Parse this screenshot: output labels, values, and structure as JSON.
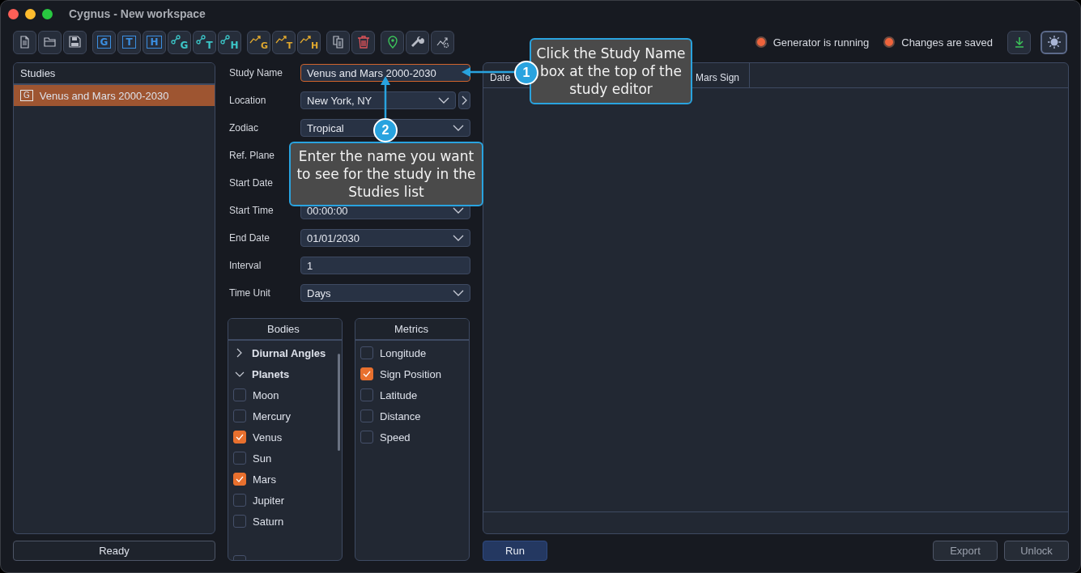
{
  "window": {
    "title": "Cygnus - New workspace"
  },
  "toolbar": [
    [
      {
        "kind": "file"
      },
      {
        "kind": "folder"
      },
      {
        "kind": "save"
      }
    ],
    [
      {
        "kind": "boxed",
        "letter": "G"
      },
      {
        "kind": "boxed",
        "letter": "T"
      },
      {
        "kind": "boxed",
        "letter": "H"
      },
      {
        "kind": "node",
        "letter": "G"
      },
      {
        "kind": "node",
        "letter": "T"
      },
      {
        "kind": "node",
        "letter": "H"
      }
    ],
    [
      {
        "kind": "trend",
        "letter": "G"
      },
      {
        "kind": "trend",
        "letter": "T"
      },
      {
        "kind": "trend",
        "letter": "H"
      }
    ],
    [
      {
        "kind": "copy"
      },
      {
        "kind": "trash"
      }
    ],
    [
      {
        "kind": "pin"
      },
      {
        "kind": "wrench"
      },
      {
        "kind": "trend-gear"
      }
    ]
  ],
  "indicators": [
    {
      "label": "Generator is running",
      "color": "#f0643c"
    },
    {
      "label": "Changes are saved",
      "color": "#f0643c"
    }
  ],
  "studies": {
    "title": "Studies",
    "items": [
      {
        "letter": "G",
        "label": "Venus and Mars 2000-2030",
        "selected": true
      }
    ]
  },
  "status": "Ready",
  "form": [
    {
      "label": "Study Name",
      "kind": "text",
      "value": "Venus and Mars 2000-2030",
      "focused": true
    },
    {
      "label": "Location",
      "kind": "dropdown",
      "value": "New York, NY",
      "more": true
    },
    {
      "label": "Zodiac",
      "kind": "dropdown",
      "value": "Tropical"
    },
    {
      "label": "Ref. Plane",
      "kind": "hidden"
    },
    {
      "label": "Start Date",
      "kind": "hidden"
    },
    {
      "label": "Start Time",
      "kind": "dropdown",
      "value": "00:00:00"
    },
    {
      "label": "End Date",
      "kind": "dropdown",
      "value": "01/01/2030"
    },
    {
      "label": "Interval",
      "kind": "text",
      "value": "1",
      "focused": false
    },
    {
      "label": "Time Unit",
      "kind": "dropdown",
      "value": "Days"
    }
  ],
  "bodies": {
    "title": "Bodies",
    "items": [
      {
        "kind": "group",
        "label": "Diurnal Angles",
        "expanded": false
      },
      {
        "kind": "group",
        "label": "Planets",
        "expanded": true
      },
      {
        "kind": "check",
        "label": "Moon",
        "checked": false
      },
      {
        "kind": "check",
        "label": "Mercury",
        "checked": false
      },
      {
        "kind": "check",
        "label": "Venus",
        "checked": true
      },
      {
        "kind": "check",
        "label": "Sun",
        "checked": false
      },
      {
        "kind": "check",
        "label": "Mars",
        "checked": true
      },
      {
        "kind": "check",
        "label": "Jupiter",
        "checked": false
      },
      {
        "kind": "check",
        "label": "Saturn",
        "checked": false
      }
    ]
  },
  "metrics": {
    "title": "Metrics",
    "items": [
      {
        "label": "Longitude",
        "checked": false
      },
      {
        "label": "Sign Position",
        "checked": true
      },
      {
        "label": "Latitude",
        "checked": false
      },
      {
        "label": "Distance",
        "checked": false
      },
      {
        "label": "Speed",
        "checked": false
      }
    ]
  },
  "table": {
    "columns": [
      "Date",
      "Mars Sign"
    ]
  },
  "buttons": [
    {
      "label": "Run",
      "primary": true
    },
    {
      "label": "Export",
      "primary": false
    },
    {
      "label": "Unlock",
      "primary": false
    }
  ],
  "callouts": [
    {
      "number": "1",
      "text": "Click the Study Name box at the top of the study editor"
    },
    {
      "number": "2",
      "text": "Enter the name you want to see for the study in the Studies list"
    }
  ]
}
